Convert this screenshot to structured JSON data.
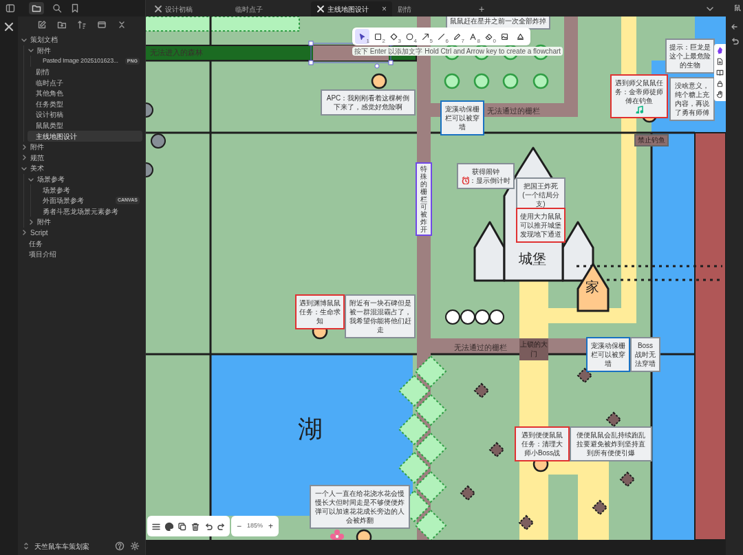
{
  "sidebar": {
    "tree": [
      {
        "label": "策划文档",
        "kind": "folder",
        "expanded": true,
        "selected": false,
        "children": [
          {
            "label": "附件",
            "kind": "folder",
            "expanded": true,
            "selected": false,
            "children": [
              {
                "label": "Pasted Image 2025101623...",
                "kind": "file",
                "badge": "PNG",
                "selected": false
              }
            ]
          },
          {
            "label": "剧情",
            "kind": "file",
            "selected": false
          },
          {
            "label": "临时点子",
            "kind": "file",
            "selected": false
          },
          {
            "label": "其他角色",
            "kind": "file",
            "selected": false
          },
          {
            "label": "任务类型",
            "kind": "file",
            "selected": false
          },
          {
            "label": "设计初稿",
            "kind": "file",
            "selected": false
          },
          {
            "label": "鼠鼠类型",
            "kind": "file",
            "selected": false
          },
          {
            "label": "主线地图设计",
            "kind": "file",
            "selected": true
          }
        ]
      },
      {
        "label": "附件",
        "kind": "folder",
        "expanded": false,
        "selected": false
      },
      {
        "label": "规范",
        "kind": "folder",
        "expanded": false,
        "selected": false
      },
      {
        "label": "美术",
        "kind": "folder",
        "expanded": true,
        "selected": false,
        "children": [
          {
            "label": "场景参考",
            "kind": "folder",
            "expanded": true,
            "selected": false,
            "children": [
              {
                "label": "场景参考",
                "kind": "file",
                "selected": false
              },
              {
                "label": "外面场景参考",
                "kind": "file",
                "badge": "CANVAS",
                "selected": false
              },
              {
                "label": "勇者斗恶龙场景元素参考",
                "kind": "file",
                "selected": false
              }
            ]
          },
          {
            "label": "附件",
            "kind": "folder",
            "expanded": false,
            "selected": false
          }
        ]
      },
      {
        "label": "Script",
        "kind": "folder",
        "expanded": false,
        "selected": false
      },
      {
        "label": "任务",
        "kind": "file",
        "selected": false
      },
      {
        "label": "项目介绍",
        "kind": "file",
        "selected": false
      }
    ],
    "vault_name": "天竺鼠车车策划案"
  },
  "tabs": [
    {
      "label": "设计初稿",
      "kind": "drawing",
      "selected": false
    },
    {
      "label": "临时点子",
      "kind": "note",
      "selected": false
    },
    {
      "label": "主线地图设计",
      "kind": "drawing",
      "selected": true,
      "close": "×"
    },
    {
      "label": "剧情",
      "kind": "note",
      "selected": false
    }
  ],
  "new_tab": "+",
  "right_panel": {
    "tab_label": "鼠"
  },
  "canvas": {
    "tools": [
      {
        "kind": "select",
        "key": "1",
        "selected": true
      },
      {
        "kind": "rectangle",
        "key": "2",
        "selected": false
      },
      {
        "kind": "diamond",
        "key": "3",
        "selected": false
      },
      {
        "kind": "ellipse",
        "key": "4",
        "selected": false
      },
      {
        "kind": "arrow",
        "key": "5",
        "selected": false
      },
      {
        "kind": "line",
        "key": "6",
        "selected": false
      },
      {
        "kind": "pencil",
        "key": "7",
        "selected": false
      },
      {
        "kind": "text",
        "key": "8",
        "selected": false
      },
      {
        "kind": "eraser",
        "key": "0",
        "selected": false
      },
      {
        "kind": "image",
        "selected": false
      },
      {
        "kind": "library",
        "selected": false
      }
    ],
    "hint": "按下 Enter 以添加文字 Hold Ctrl and Arrow key to create a flowchart",
    "items": [
      {
        "kind": "note",
        "text": "鼠鼠赶在星井之前一次全部炸掉",
        "color": "#868e96"
      },
      {
        "kind": "label",
        "text": "无法进入的森林"
      },
      {
        "kind": "note",
        "text": "APC：我刚刚看着这棵树倒下来了，感觉好危险啊",
        "color": "#868e96"
      },
      {
        "kind": "note",
        "text": "宠溪动保栅栏可以被穿墙",
        "color": "#1971c2"
      },
      {
        "kind": "label",
        "text": "无法通过的栅栏"
      },
      {
        "kind": "vertical_note",
        "text": "特殊的栅栏可被炸开",
        "color": "#7048e8"
      },
      {
        "kind": "note",
        "text": "获得闹钟",
        "text_after": "：显示倒计时",
        "color": "#868e96"
      },
      {
        "kind": "note",
        "text": "把国王炸死(一个结局分支)",
        "color": "#868e96"
      },
      {
        "kind": "note",
        "text": "使用大力鼠鼠可以推开城堡发现地下通道",
        "color": "#e03131"
      },
      {
        "kind": "big",
        "text": "城堡"
      },
      {
        "kind": "big",
        "text": "家"
      },
      {
        "kind": "note",
        "text": "提示：巨龙是这个上最危险的生物",
        "color": "#868e96"
      },
      {
        "kind": "note",
        "text": "遇到师父鼠鼠任务：金帝师徒师傅在钓鱼",
        "color": "#e03131"
      },
      {
        "kind": "note",
        "text": "没啥意义，纯个糖上充内容，再说了勇有师傅",
        "color": "#868e96"
      },
      {
        "kind": "sign",
        "text": "禁止钓鱼"
      },
      {
        "kind": "note",
        "text": "遇到渊博鼠鼠任务：生命求知",
        "color": "#e03131"
      },
      {
        "kind": "note",
        "text": "附近有一块石碑但是被一群混混霸占了，我希望你能将他们赶走",
        "color": "#868e96"
      },
      {
        "kind": "label",
        "text": "无法通过的栅栏"
      },
      {
        "kind": "gate",
        "text": "上锁的大门"
      },
      {
        "kind": "note",
        "text": "宠溪动保栅栏可以被穿墙",
        "color": "#1971c2"
      },
      {
        "kind": "note",
        "text": "Boss 战时无法穿墙",
        "color": "#868e96"
      },
      {
        "kind": "big",
        "text": "湖"
      },
      {
        "kind": "note",
        "text": "遇到便便鼠鼠任务：清理大师小Boss战",
        "color": "#e03131"
      },
      {
        "kind": "note",
        "text": "便便鼠鼠会乱持续跑乱拉要避免被炸到坚持直到所有便便引爆",
        "color": "#868e96"
      },
      {
        "kind": "note",
        "text": "一个人一直在给花浇水花会慢慢长大但时间走是不够便便炸弹可以加速花花成长旁边的人会被炸翻",
        "color": "#868e96"
      }
    ],
    "zoom": {
      "minus": "−",
      "value": "185%",
      "plus": "+"
    }
  }
}
